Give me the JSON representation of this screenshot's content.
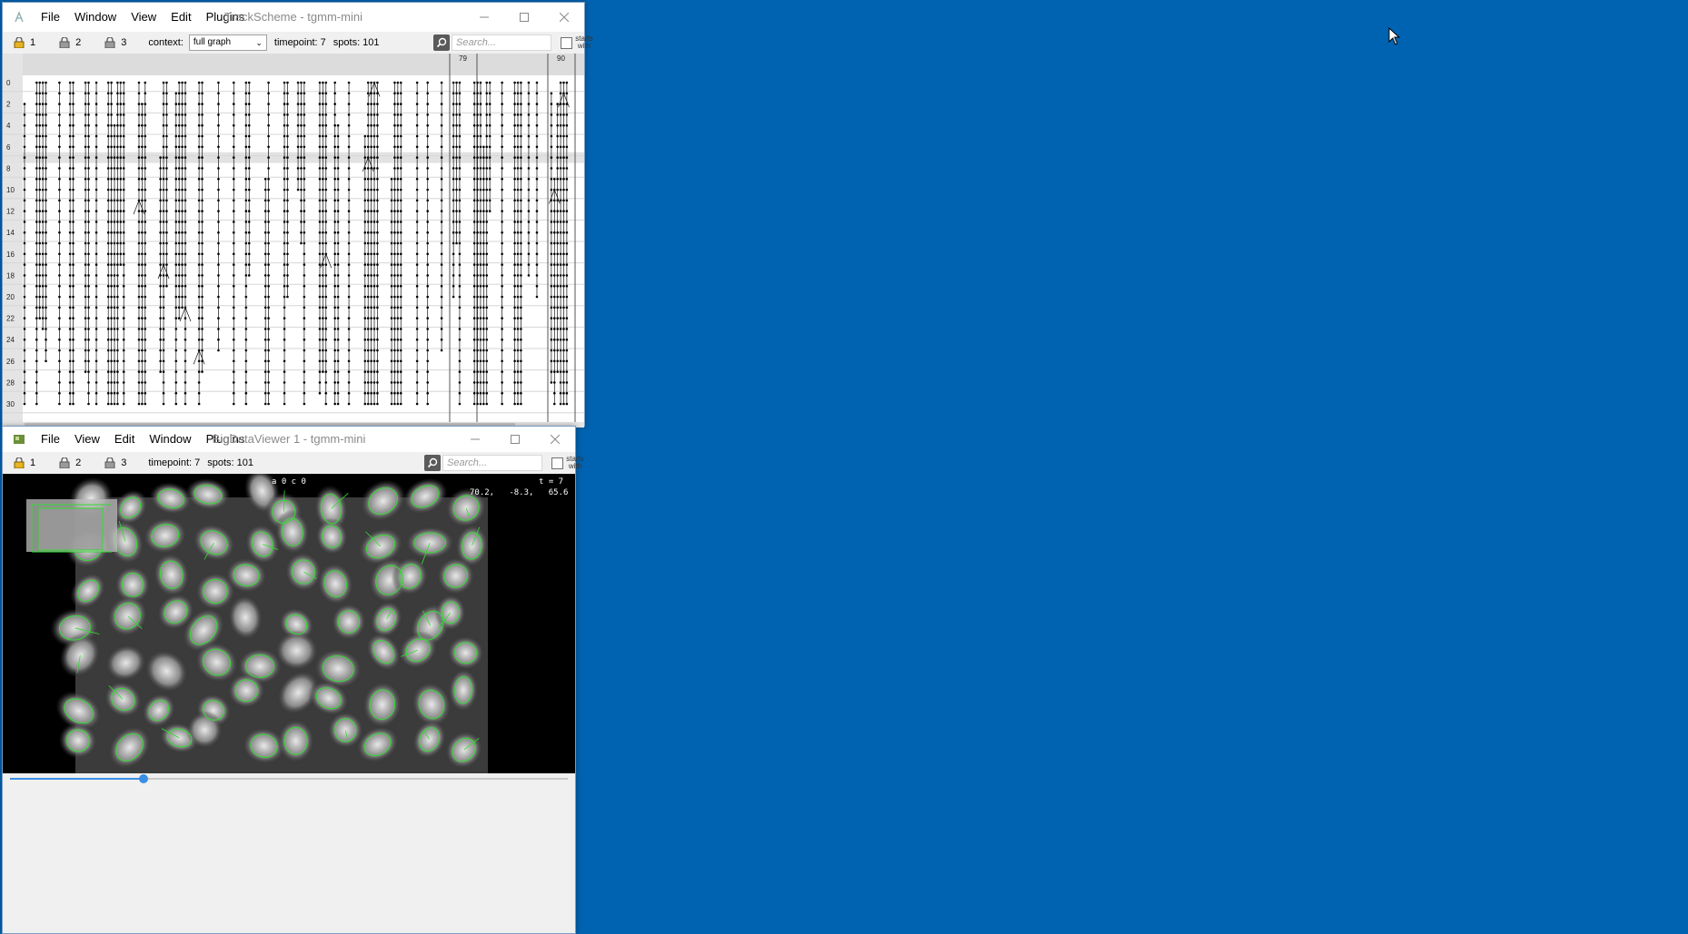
{
  "trackscheme": {
    "title": "TrackScheme - tgmm-mini",
    "menu": [
      "File",
      "Window",
      "View",
      "Edit",
      "Plugins"
    ],
    "locks": [
      "1",
      "2",
      "3"
    ],
    "context_label": "context:",
    "context_value": "full graph",
    "timepoint": "timepoint: 7",
    "spots": "spots: 101",
    "search_placeholder": "Search...",
    "starts_with": "starts with",
    "column_labels": [
      "79",
      "90"
    ],
    "row_labels": [
      "0",
      "2",
      "4",
      "6",
      "8",
      "10",
      "12",
      "14",
      "16",
      "18",
      "20",
      "22",
      "24",
      "26",
      "28",
      "30"
    ],
    "highlight_timepoint": 7
  },
  "bdv": {
    "title": "BigDataViewer 1 - tgmm-mini",
    "menu": [
      "File",
      "View",
      "Edit",
      "Window",
      "Plugins"
    ],
    "locks": [
      "1",
      "2",
      "3"
    ],
    "timepoint": "timepoint: 7",
    "spots": "spots: 101",
    "search_placeholder": "Search...",
    "starts_with": "starts with",
    "source_label": "a 0 c 0",
    "time_label": "t = 7",
    "coords": "70.2,   -8.3,   65.6",
    "slider_fraction": 0.24
  },
  "colors": {
    "desktop": "#0063b1",
    "overlay_green": "#33dd33",
    "accent": "#3a8ee6"
  }
}
